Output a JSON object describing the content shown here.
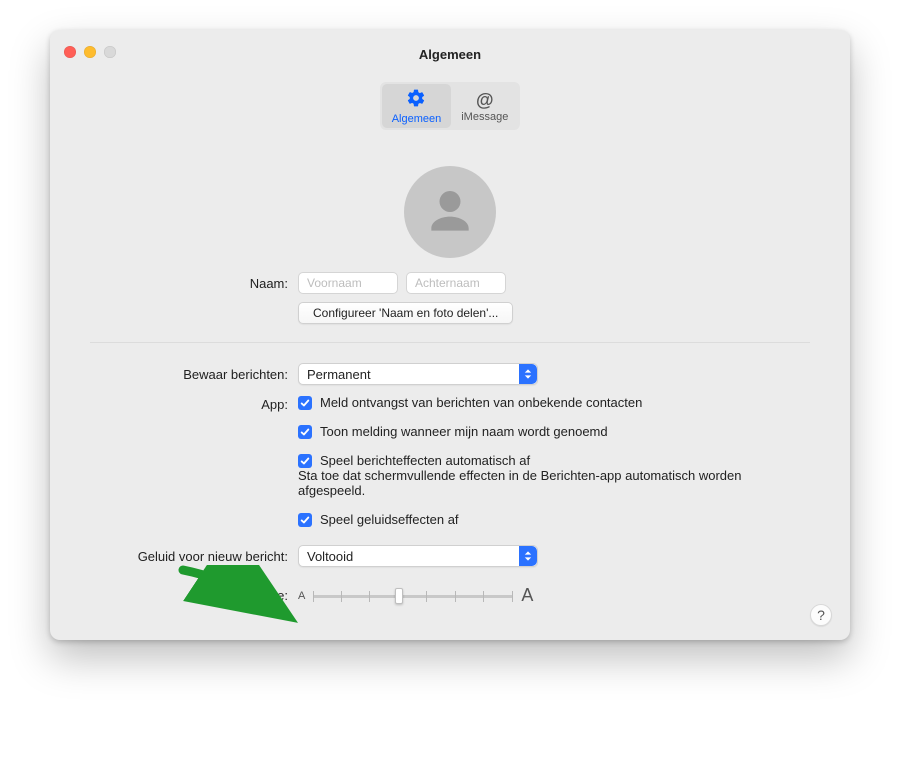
{
  "window": {
    "title": "Algemeen"
  },
  "tabs": {
    "general": {
      "label": "Algemeen"
    },
    "imessage": {
      "label": "iMessage"
    }
  },
  "name": {
    "label": "Naam:",
    "first_placeholder": "Voornaam",
    "last_placeholder": "Achternaam"
  },
  "share_button": "Configureer 'Naam en foto delen'...",
  "retention": {
    "label": "Bewaar berichten:",
    "value": "Permanent"
  },
  "app": {
    "label": "App:",
    "opt1": "Meld ontvangst van berichten van onbekende contacten",
    "opt2": "Toon melding wanneer mijn naam wordt genoemd",
    "opt3": "Speel berichteffecten automatisch af",
    "opt3_desc": "Sta toe dat schermvullende effecten in de Berichten-app automatisch worden afgespeeld.",
    "opt4": "Speel geluidseffecten af"
  },
  "sound": {
    "label": "Geluid voor nieuw bericht:",
    "value": "Voltooid"
  },
  "textsize": {
    "label": "Tekstgrootte:",
    "small": "A",
    "big": "A"
  },
  "help": "?"
}
